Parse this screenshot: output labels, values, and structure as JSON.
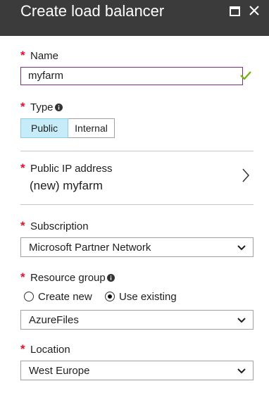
{
  "window": {
    "title": "Create load balancer",
    "icons": [
      "maximize-icon",
      "close-icon"
    ]
  },
  "colors": {
    "titlebar": "#3b3b3b",
    "required": "#e81123",
    "valid_check": "#6bb700",
    "focus_border": "#7a2e8e",
    "selected_toggle": "#c6ecfa"
  },
  "form": {
    "required_mark": "*",
    "name": {
      "label": "Name",
      "value": "myfarm",
      "status_icon": "check-icon"
    },
    "type": {
      "label": "Type",
      "info_icon": "info-icon",
      "options": [
        "Public",
        "Internal"
      ],
      "selected": "Public"
    },
    "public_ip": {
      "label": "Public IP address",
      "value": "(new) myfarm",
      "nav_icon": "chevron-right-icon"
    },
    "subscription": {
      "label": "Subscription",
      "value": "Microsoft Partner Network"
    },
    "resource_group": {
      "label": "Resource group",
      "info_icon": "info-icon",
      "option_create": "Create new",
      "option_existing": "Use existing",
      "selected_option": "Use existing",
      "value": "AzureFiles"
    },
    "location": {
      "label": "Location",
      "value": "West Europe"
    }
  }
}
